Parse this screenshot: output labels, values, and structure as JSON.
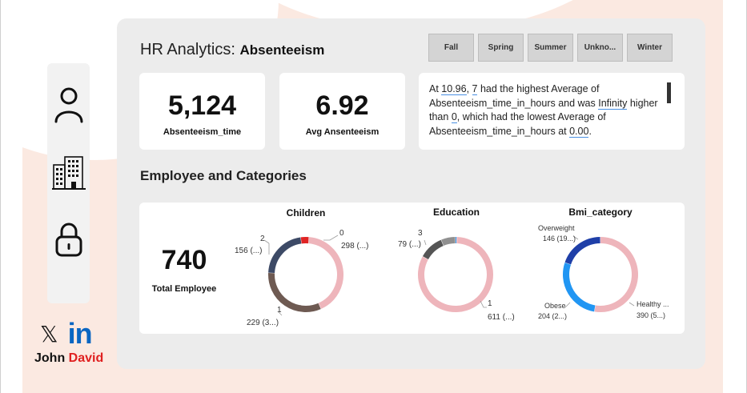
{
  "header": {
    "title_prefix": "HR Analytics:",
    "title_bold": "Absenteeism"
  },
  "seasons": [
    "Fall",
    "Spring",
    "Summer",
    "Unkno...",
    "Winter"
  ],
  "kpis": [
    {
      "value": "5,124",
      "label": "Absenteeism_time"
    },
    {
      "value": "6.92",
      "label": "Avg Ansenteeism"
    }
  ],
  "insight": {
    "p1": "At ",
    "v1": "10.96",
    "p2": ", ",
    "v2": "7",
    "p3": " had the highest Average of Absenteeism_time_in_hours and was ",
    "v3": "Infinity",
    "p4": " higher than ",
    "v4": "0",
    "p5": ", which had the lowest Average of Absenteeism_time_in_hours at ",
    "v5": "0.00",
    "p6": "."
  },
  "section_title": "Employee and Categories",
  "total": {
    "value": "740",
    "label": "Total Employee"
  },
  "sidebar": {
    "icons": [
      "user-icon",
      "building-icon",
      "lock-icon"
    ]
  },
  "social": {
    "x": "𝕏",
    "linkedin": "in"
  },
  "author": {
    "first": "John",
    "last": "David"
  },
  "colors": {
    "pink": "#eeb5bb",
    "dark_blue": "#1f3fa8",
    "blue": "#2196f3",
    "slate": "#3d4a66",
    "brown": "#6e5a52",
    "red": "#e02424",
    "gray": "#808080"
  },
  "chart_data": [
    {
      "type": "pie",
      "title": "Children",
      "series": [
        {
          "name": "0",
          "value": 298,
          "label": "298 (...)",
          "color": "#eeb5bb"
        },
        {
          "name": "1",
          "value": 229,
          "label": "229 (3...)",
          "color": "#6e5a52"
        },
        {
          "name": "2",
          "value": 156,
          "label": "156 (...)",
          "color": "#3d4a66"
        },
        {
          "name": "",
          "value": 25,
          "label": "",
          "color": "#e02424"
        }
      ]
    },
    {
      "type": "pie",
      "title": "Education",
      "series": [
        {
          "name": "1",
          "value": 611,
          "label": "611 (...)",
          "color": "#eeb5bb"
        },
        {
          "name": "3",
          "value": 79,
          "label": "79 (...)",
          "color": "#555555"
        },
        {
          "name": "",
          "value": 46,
          "label": "",
          "color": "#909090"
        },
        {
          "name": "",
          "value": 4,
          "label": "",
          "color": "#1e88e5"
        }
      ]
    },
    {
      "type": "pie",
      "title": "Bmi_category",
      "series": [
        {
          "name": "Healthy ...",
          "value": 390,
          "label": "390 (5...)",
          "color": "#eeb5bb"
        },
        {
          "name": "Obese",
          "value": 204,
          "label": "204 (2...)",
          "color": "#2196f3"
        },
        {
          "name": "Overweight",
          "value": 146,
          "label": "146 (19...)",
          "color": "#1f3fa8"
        }
      ]
    }
  ]
}
